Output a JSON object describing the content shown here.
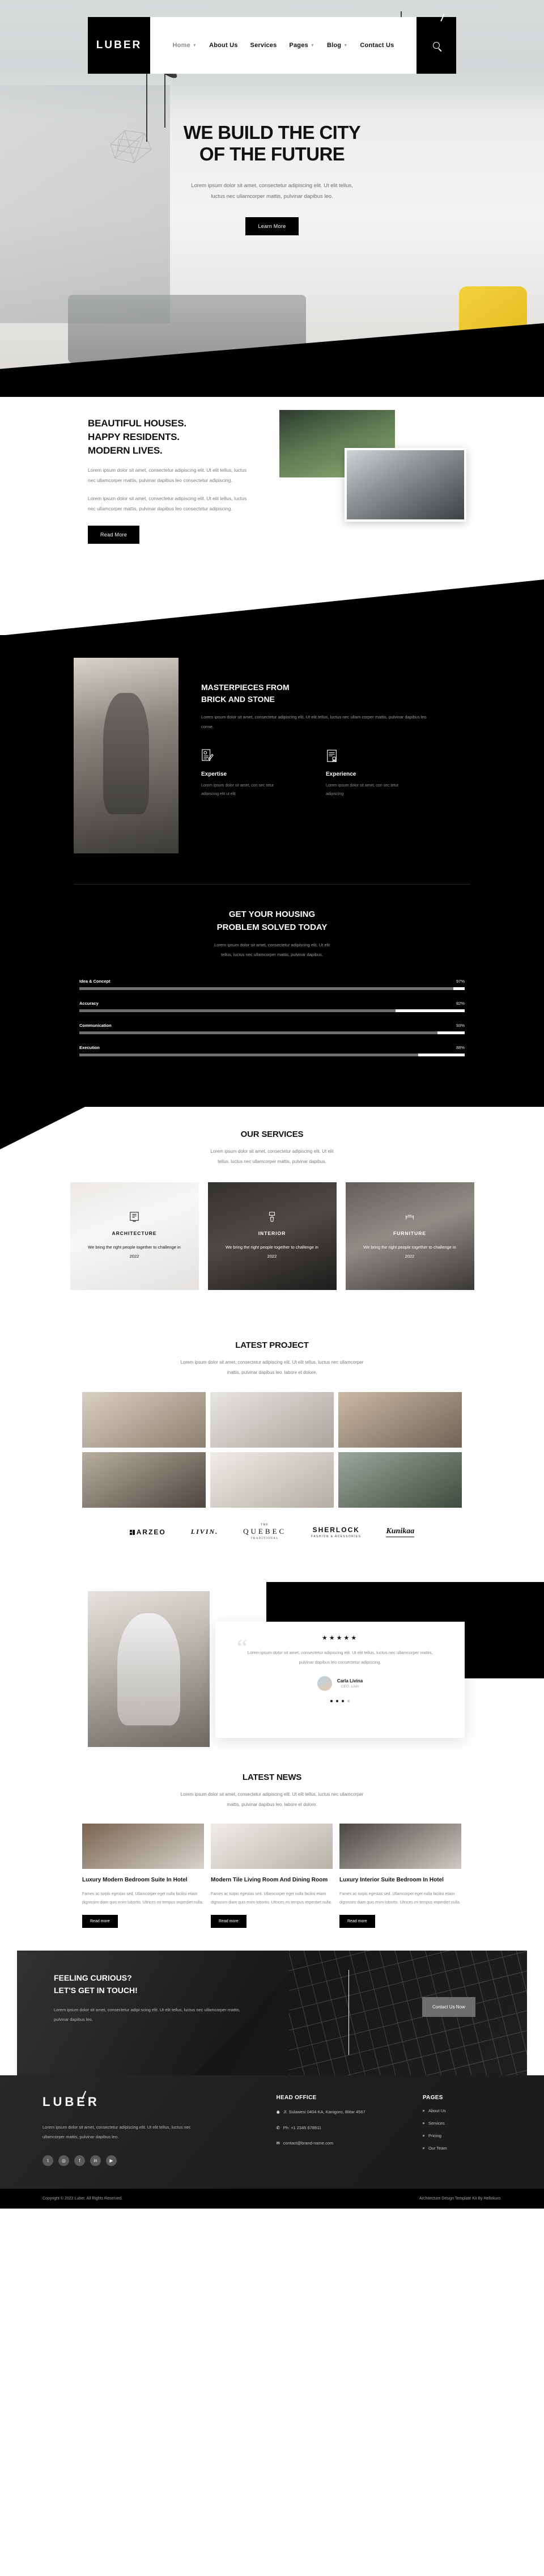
{
  "brand": {
    "name": "LUBER"
  },
  "nav": {
    "items": [
      {
        "label": "Home",
        "caret": true,
        "active": true
      },
      {
        "label": "About Us",
        "caret": false,
        "active": false
      },
      {
        "label": "Services",
        "caret": false,
        "active": false
      },
      {
        "label": "Pages",
        "caret": true,
        "active": false
      },
      {
        "label": "Blog",
        "caret": true,
        "active": false
      },
      {
        "label": "Contact Us",
        "caret": false,
        "active": false
      }
    ],
    "search_icon": "search-icon"
  },
  "hero": {
    "title_line1": "WE BUILD THE CITY",
    "title_line2": "OF THE FUTURE",
    "subtitle_line1": "Lorem ipsum dolor sit amet, consectetur adipiscing elit. Ut elit tellus,",
    "subtitle_line2": "luctus nec ullamcorper mattis, pulvinar dapibus leo.",
    "cta_label": "Learn More"
  },
  "houses": {
    "title_line1": "BEAUTIFUL HOUSES.",
    "title_line2": "HAPPY RESIDENTS.",
    "title_line3": "MODERN LIVES.",
    "paragraph1": "Lorem ipsum dolor sit amet, consectetur adipiscing elit. Ut elit tellus, luctus nec ullamcorper mattis, pulvinar dapibus leo consectetur adipiscing.",
    "paragraph2": "Lorem ipsum dolor sit amet, consectetur adipiscing elit. Ut elit tellus, luctus nec ullamcorper mattis, pulvinar dapibus leo consectetur adipiscing.",
    "cta_label": "Read More"
  },
  "masterpieces": {
    "title_line1": "MASTERPIECES FROM",
    "title_line2": "BRICK AND STONE",
    "paragraph": "Lorem ipsum dolor sit amet, consectetur adipiscing elit. Ut elit tellus, luctus nec ullam corper mattis, pulvinar dapibus leo conse.",
    "features": [
      {
        "icon": "document-pencil-icon",
        "title": "Expertise",
        "body": "Lorem ipsum dolor sit amet, con sec tetur adipiscing elit ut elit"
      },
      {
        "icon": "certificate-icon",
        "title": "Experience",
        "body": "Lorem ipsum dolor sit amet, con sec tetur adipiscing"
      }
    ]
  },
  "housing": {
    "title_line1": "GET YOUR HOUSING",
    "title_line2": "PROBLEM SOLVED TODAY",
    "subtitle_line1": "Lorem ipsum dolor sit amet, consectetur adipiscing elit. Ut elit",
    "subtitle_line2": "tellus, luctus nec ullamcorper mattis, pulvinar dapibus.",
    "bars": [
      {
        "label": "Idea & Concept",
        "percent": 97,
        "percent_label": "97%"
      },
      {
        "label": "Accuracy",
        "percent": 82,
        "percent_label": "82%"
      },
      {
        "label": "Communication",
        "percent": 93,
        "percent_label": "93%"
      },
      {
        "label": "Execution",
        "percent": 88,
        "percent_label": "88%"
      }
    ]
  },
  "services": {
    "title": "OUR SERVICES",
    "subtitle_line1": "Lorem ipsum dolor sit amet, consectetur adipiscing elit. Ut elit",
    "subtitle_line2": "tellus, luctus nec ullamcorper mattis, pulvinar dapibus.",
    "cards": [
      {
        "icon": "blueprint-icon",
        "title": "ARCHITECTURE",
        "body": "We bring the right people together to challenge in 2022"
      },
      {
        "icon": "paint-roller-icon",
        "title": "INTERIOR",
        "body": "We bring the right people together to challenge in 2022"
      },
      {
        "icon": "sofa-icon",
        "title": "FURNITURE",
        "body": "We bring the right people together to challenge in 2022"
      }
    ]
  },
  "project": {
    "title": "LATEST PROJECT",
    "subtitle_line1": "Lorem ipsum dolor sit amet, consectetur adipiscing elit. Ut elit tellus, luctus nec ullamcorper",
    "subtitle_line2": "mattis, pulvinar dapibus leo. labore et dolore."
  },
  "brands": [
    {
      "name": "ARZEO",
      "style": "sq",
      "sub": "",
      "top": ""
    },
    {
      "name": "LIVIN.",
      "style": "italic",
      "sub": "",
      "top": ""
    },
    {
      "name": "QUEBEC",
      "style": "serif",
      "sub": "TRADITIONAL",
      "top": "THE"
    },
    {
      "name": "SHERLOCK",
      "style": "plain",
      "sub": "FASHION & ACESSORIES",
      "top": ""
    },
    {
      "name": "Kunikaa",
      "style": "script",
      "sub": "",
      "top": ""
    }
  ],
  "testimonial": {
    "stars": "★★★★★",
    "quote_line1": "Lorem ipsum dolor sit amet, consectetur adipiscing elit. Ut elit tellus, luctus nec",
    "quote_line2": "ullamcorper mattis, pulvinar dapibus leo consectetur adipiscing.",
    "author_name": "Carla Livina",
    "author_role": "CEO, Livin",
    "dots_total": 4,
    "dots_active": 3
  },
  "news": {
    "title": "LATEST NEWS",
    "subtitle_line1": "Lorem ipsum dolor sit amet, consectetur adipiscing elit. Ut elit tellus, luctus nec ullamcorper",
    "subtitle_line2": "mattis, pulvinar dapibus leo. labore et dolore.",
    "posts": [
      {
        "title": "Luxury Modern Bedroom Suite In Hotel",
        "body": "Fames ac turpis egestas sed. Ullamcorper eget nulla facilisi etiam dignissim diam quis enim lobortis. Ultrices mi tempus imperdiet nulla.",
        "cta": "Read more"
      },
      {
        "title": "Modern Tile Living Room And Dining Room",
        "body": "Fames ac turpis egestas sed. Ullamcorper eget nulla facilisi etiam dignissim diam quis enim lobortis. Ultrices mi tempus imperdiet nulla.",
        "cta": "Read more"
      },
      {
        "title": "Luxury Interior Suite Bedroom In Hotel",
        "body": "Fames ac turpis egestas sed. Ullamcorper eget nulla facilisi etiam dignissim diam quis enim lobortis. Ultrices mi tempus imperdiet nulla.",
        "cta": "Read more"
      }
    ]
  },
  "cta": {
    "title_line1": "FEELING CURIOUS?",
    "title_line2": "LET'S GET IN TOUCH!",
    "body": "Lorem ipsum dolor sit amet, consectetur adipi scing elit. Ut elit tellus, luctus nec ullamcorper mattis, pulvinar dapibus leo.",
    "button_label": "Contact Us Now"
  },
  "footer": {
    "logo": "LUBER",
    "description": "Lorem ipsum dolor sit amet, consectetur adipiscing elit. Ut elit tellus, luctus nec ullamcorper mattis, pulvinar dapibus leo.",
    "socials": [
      {
        "icon": "twitter-icon",
        "glyph": "t"
      },
      {
        "icon": "instagram-icon",
        "glyph": "◎"
      },
      {
        "icon": "facebook-icon",
        "glyph": "f"
      },
      {
        "icon": "linkedin-icon",
        "glyph": "in"
      },
      {
        "icon": "youtube-icon",
        "glyph": "▶"
      }
    ],
    "office": {
      "heading": "HEAD OFFICE",
      "address": "Jl. Sulawesi 0404 KA, Kanigoro, Blitar 4567",
      "phone": "Ph: +1 2345 678911",
      "email": "contact@brand-name.com"
    },
    "pages": {
      "heading": "PAGES",
      "links": [
        "About Us",
        "Services",
        "Pricing",
        "Our Team"
      ]
    },
    "copyright": "Copyright © 2022 Luber, All Rights Reserved.",
    "credit": "Architecture Design Template Kit By Hellokuro."
  }
}
